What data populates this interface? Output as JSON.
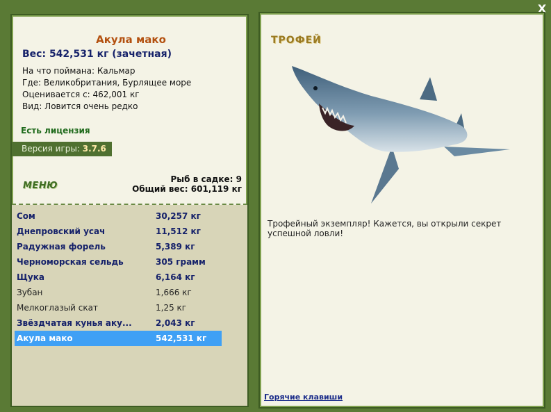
{
  "close_label": "X",
  "fish": {
    "name": "Акула мако",
    "weight": "Вес: 542,531 кг (зачетная)",
    "caught_on": "На что поймана: Кальмар",
    "where": "Где: Великобритания, Бурлящее море",
    "valued_from": "Оценивается с: 462,001 кг",
    "kind": "Вид: Ловится очень редко"
  },
  "license": "Есть лицензия",
  "version": {
    "label": "Версия игры:",
    "value": "3.7.6"
  },
  "menu_label": "МЕНЮ",
  "keep": {
    "count": "Рыб в садке: 9",
    "total": "Общий вес: 601,119 кг"
  },
  "catch_list": [
    {
      "name": "Сом",
      "weight": "30,257 кг",
      "trophy": true
    },
    {
      "name": "Днепровский усач",
      "weight": "11,512 кг",
      "trophy": true
    },
    {
      "name": "Радужная форель",
      "weight": "5,389 кг",
      "trophy": true
    },
    {
      "name": "Черноморская сельдь",
      "weight": "305 грамм",
      "trophy": true
    },
    {
      "name": "Щука",
      "weight": "6,164 кг",
      "trophy": true
    },
    {
      "name": "Зубан",
      "weight": "1,666 кг",
      "trophy": false
    },
    {
      "name": "Мелкоглазый скат",
      "weight": "1,25 кг",
      "trophy": false
    },
    {
      "name": "Звёздчатая кунья аку...",
      "weight": "2,043 кг",
      "trophy": true
    },
    {
      "name": "Акула мако",
      "weight": "542,531 кг",
      "trophy": true,
      "selected": true
    }
  ],
  "trophy": {
    "title": "ТРОФЕЙ",
    "description": "Трофейный экземпляр! Кажется, вы открыли секрет успешной ловли!"
  },
  "hotkeys_label": "Горячие клавиши",
  "image": {
    "icon": "mako-shark-picture"
  },
  "colors": {
    "frame": "#5a7a35",
    "panel": "#f4f3e6",
    "title": "#b3500f",
    "trophy_text": "#16226a",
    "selected_row": "#3fa0f5"
  }
}
